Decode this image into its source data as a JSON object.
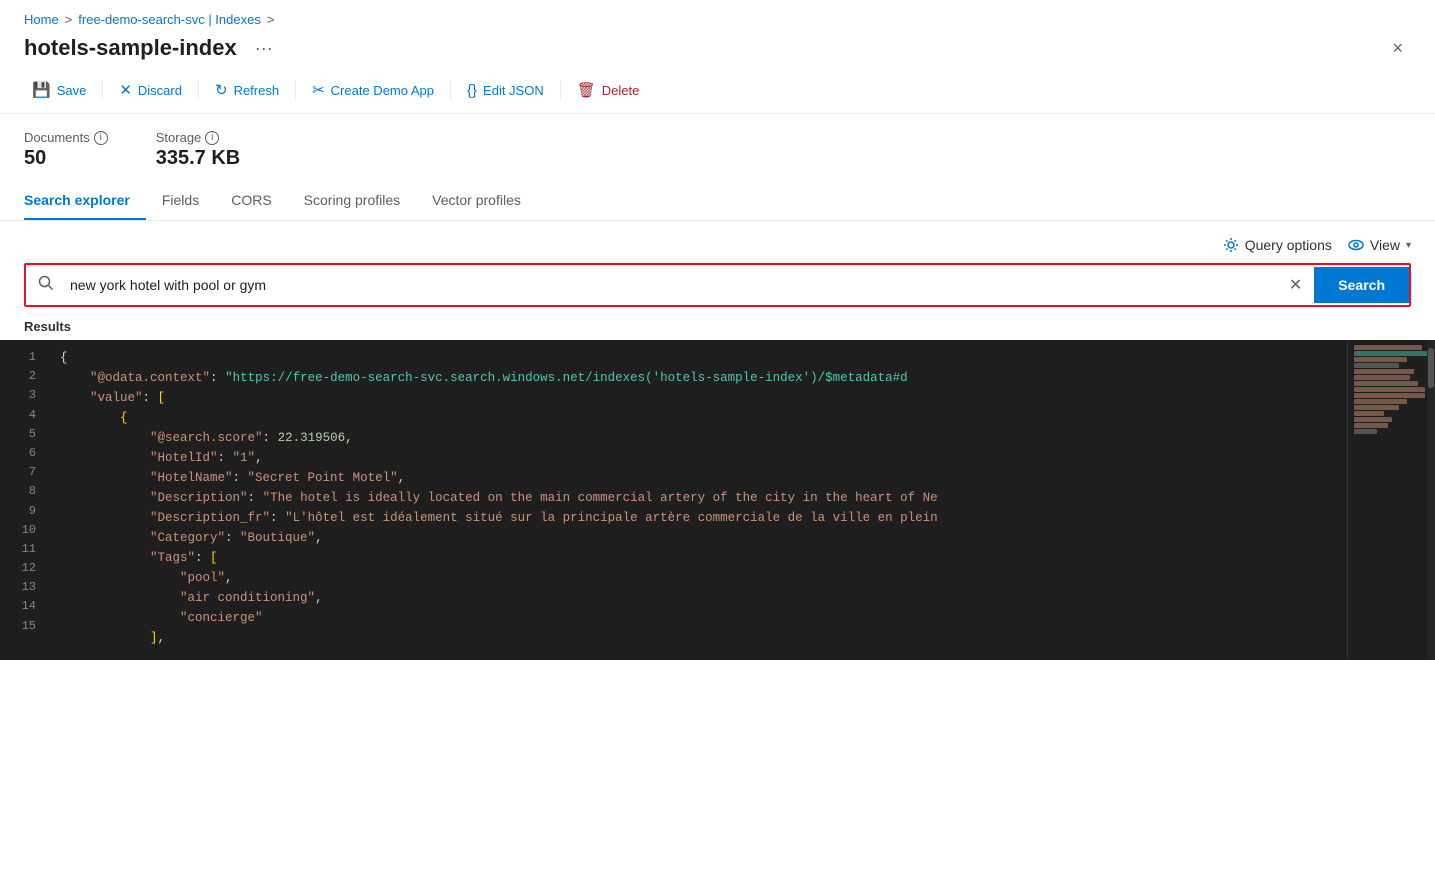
{
  "breadcrumb": {
    "home": "Home",
    "separator1": ">",
    "service": "free-demo-search-svc | Indexes",
    "separator2": ">"
  },
  "header": {
    "title": "hotels-sample-index",
    "ellipsis": "···",
    "close": "×"
  },
  "toolbar": {
    "save": "Save",
    "discard": "Discard",
    "refresh": "Refresh",
    "createDemoApp": "Create Demo App",
    "editJSON": "Edit JSON",
    "delete": "Delete"
  },
  "stats": {
    "documents_label": "Documents",
    "documents_value": "50",
    "storage_label": "Storage",
    "storage_value": "335.7 KB"
  },
  "tabs": [
    {
      "id": "search-explorer",
      "label": "Search explorer",
      "active": true
    },
    {
      "id": "fields",
      "label": "Fields",
      "active": false
    },
    {
      "id": "cors",
      "label": "CORS",
      "active": false
    },
    {
      "id": "scoring-profiles",
      "label": "Scoring profiles",
      "active": false
    },
    {
      "id": "vector-profiles",
      "label": "Vector profiles",
      "active": false
    }
  ],
  "search": {
    "query_options_label": "Query options",
    "view_label": "View",
    "search_placeholder": "new york hotel with pool or gym",
    "search_value": "new york hotel with pool or gym",
    "search_button": "Search",
    "results_label": "Results"
  },
  "results": {
    "lines": [
      {
        "num": 1,
        "content": "{"
      },
      {
        "num": 2,
        "content": "    \"@odata.context\": \"https://free-demo-search-svc.search.windows.net/indexes('hotels-sample-index')/$metadata#d"
      },
      {
        "num": 3,
        "content": "    \"value\": ["
      },
      {
        "num": 4,
        "content": "        {"
      },
      {
        "num": 5,
        "content": "            \"@search.score\": 22.319506,"
      },
      {
        "num": 6,
        "content": "            \"HotelId\": \"1\","
      },
      {
        "num": 7,
        "content": "            \"HotelName\": \"Secret Point Motel\","
      },
      {
        "num": 8,
        "content": "            \"Description\": \"The hotel is ideally located on the main commercial artery of the city in the heart of Ne"
      },
      {
        "num": 9,
        "content": "            \"Description_fr\": \"L'hôtel est idéalement situé sur la principale artère commerciale de la ville en plein"
      },
      {
        "num": 10,
        "content": "            \"Category\": \"Boutique\","
      },
      {
        "num": 11,
        "content": "            \"Tags\": ["
      },
      {
        "num": 12,
        "content": "                \"pool\","
      },
      {
        "num": 13,
        "content": "                \"air conditioning\","
      },
      {
        "num": 14,
        "content": "                \"concierge\""
      },
      {
        "num": 15,
        "content": "            ],"
      }
    ]
  }
}
